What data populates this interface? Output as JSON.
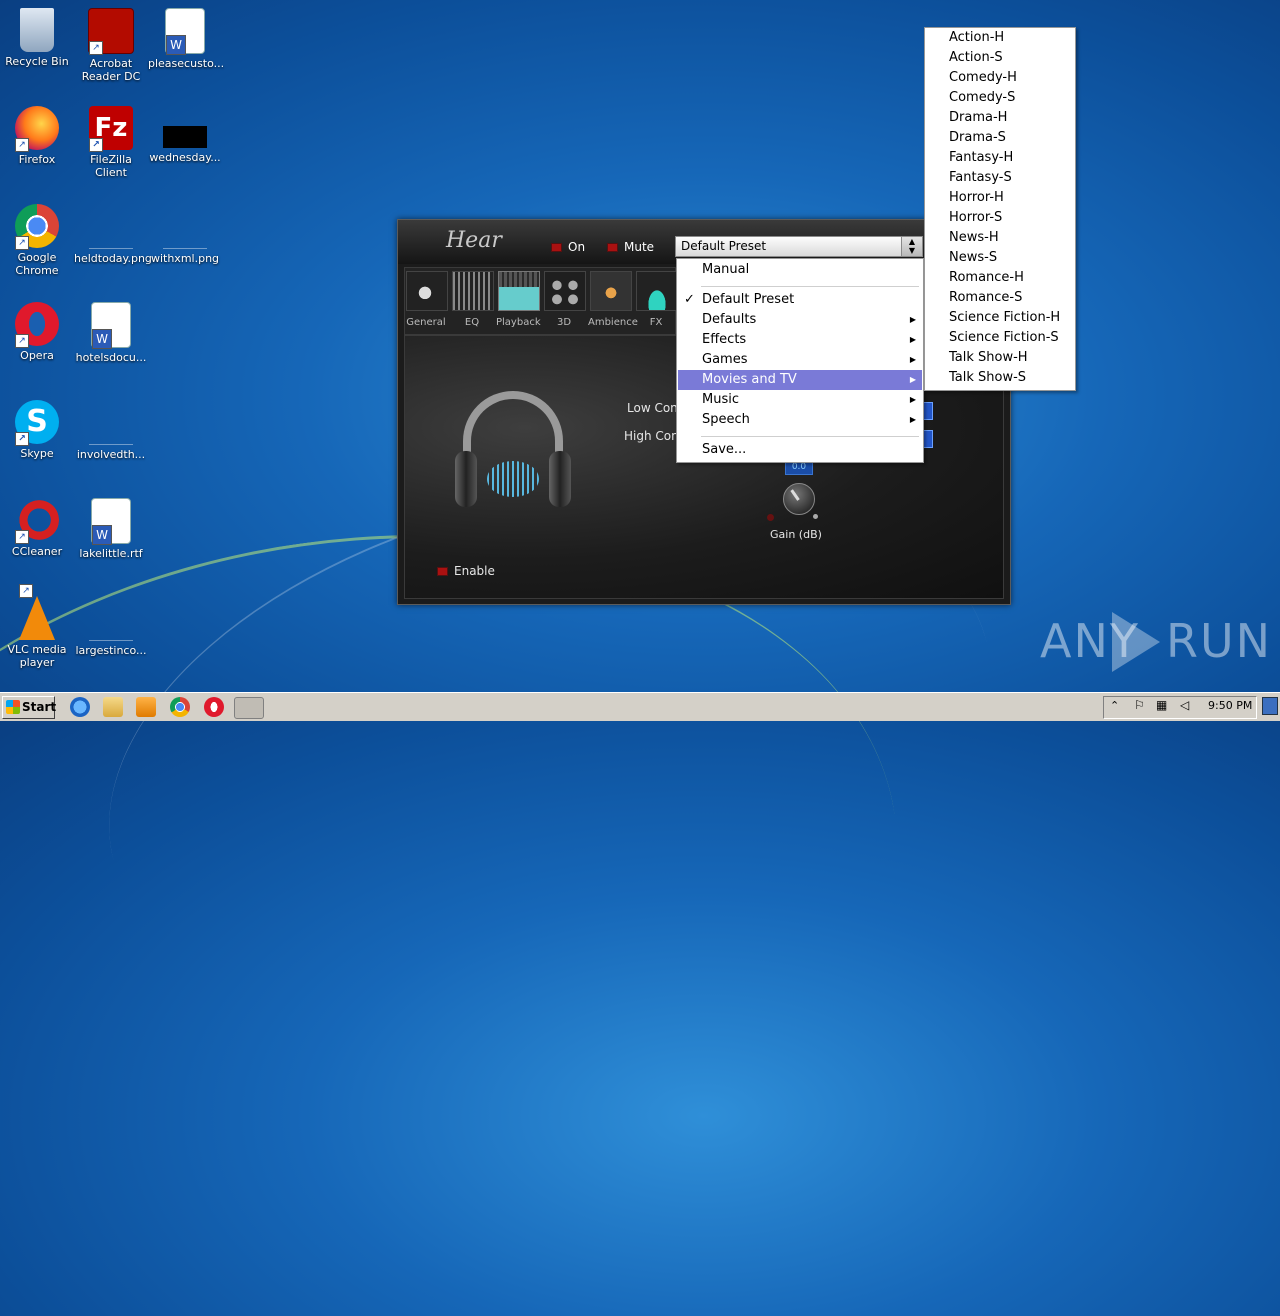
{
  "desktop": {
    "icons": [
      {
        "label": "Recycle Bin"
      },
      {
        "label": "Acrobat Reader DC"
      },
      {
        "label": "pleasecusto..."
      },
      {
        "label": "Firefox"
      },
      {
        "label": "FileZilla Client"
      },
      {
        "label": "wednesday..."
      },
      {
        "label": "Google Chrome"
      },
      {
        "label": "heldtoday.png"
      },
      {
        "label": "withxml.png"
      },
      {
        "label": "Opera"
      },
      {
        "label": "hotelsdocu..."
      },
      {
        "label": "Skype"
      },
      {
        "label": "involvedth..."
      },
      {
        "label": "CCleaner"
      },
      {
        "label": "lakelittle.rtf"
      },
      {
        "label": "VLC media player"
      },
      {
        "label": "largestinco..."
      }
    ]
  },
  "hear_window": {
    "title": "Hear",
    "on_label": "On",
    "mute_label": "Mute",
    "preset_value": "Default Preset",
    "tabs": [
      {
        "label": "General"
      },
      {
        "label": "EQ"
      },
      {
        "label": "Playback"
      },
      {
        "label": "3D"
      },
      {
        "label": "Ambience"
      },
      {
        "label": "FX"
      }
    ],
    "low_contrast_label": "Low Cont",
    "high_contrast_label": "High Cont",
    "gain_value": "0.0",
    "gain_label": "Gain (dB)",
    "enable_label": "Enable"
  },
  "preset_menu": {
    "items": {
      "manual": "Manual",
      "default_preset": "Default Preset",
      "defaults": "Defaults",
      "effects": "Effects",
      "games": "Games",
      "movies_tv": "Movies and TV",
      "music": "Music",
      "speech": "Speech",
      "save": "Save..."
    },
    "checked": "Default Preset",
    "highlighted": "Movies and TV",
    "highlight_color": "#7a7ad7"
  },
  "movies_submenu": {
    "items": [
      "Action-H",
      "Action-S",
      "Comedy-H",
      "Comedy-S",
      "Drama-H",
      "Drama-S",
      "Fantasy-H",
      "Fantasy-S",
      "Horror-H",
      "Horror-S",
      "News-H",
      "News-S",
      "Romance-H",
      "Romance-S",
      "Science Fiction-H",
      "Science Fiction-S",
      "Talk Show-H",
      "Talk Show-S"
    ]
  },
  "watermark": {
    "text_left": "ANY",
    "text_right": "RUN"
  },
  "taskbar": {
    "start_label": "Start",
    "clock": "9:50 PM"
  }
}
